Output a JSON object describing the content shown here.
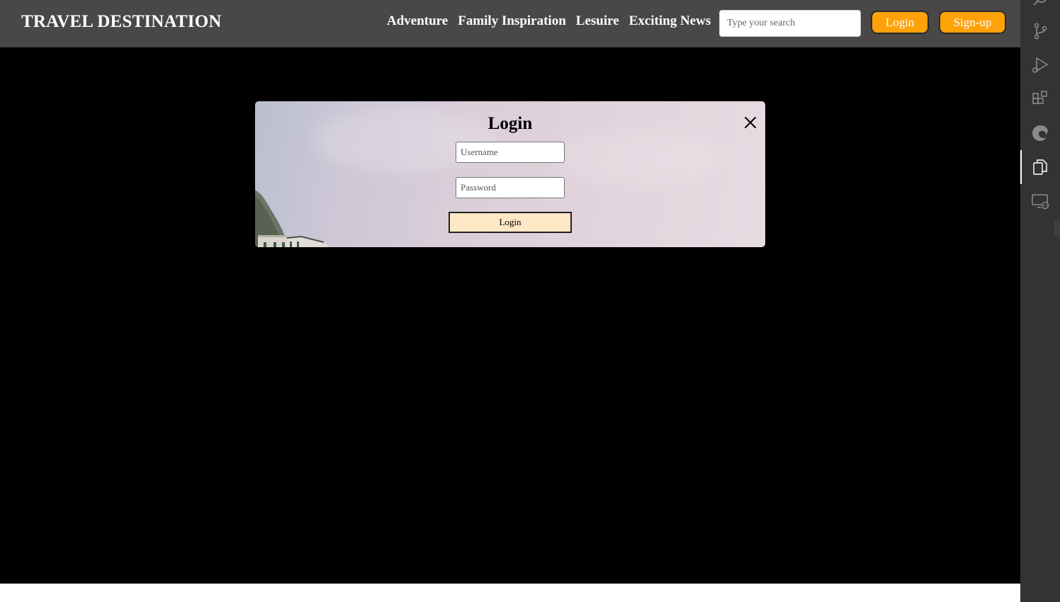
{
  "navbar": {
    "brand": "TRAVEL DESTINATION",
    "links": [
      "Adventure",
      "Family Inspiration",
      "Lesuire",
      "Exciting News"
    ],
    "search_placeholder": "Type your search",
    "login_label": "Login",
    "signup_label": "Sign-up",
    "accent_color": "#ffa20a",
    "background_color": "#4a4747"
  },
  "login_modal": {
    "title": "Login",
    "username_placeholder": "Username",
    "password_placeholder": "Password",
    "submit_label": "Login",
    "close_icon": "close-icon",
    "submit_color": "#fde7c4"
  },
  "activity_bar": {
    "icons": [
      "search-icon",
      "source-control-icon",
      "run-debug-icon",
      "extensions-icon",
      "edge-browser-icon",
      "copy-files-icon",
      "remote-explorer-icon"
    ],
    "active_icon": "copy-files-icon"
  }
}
